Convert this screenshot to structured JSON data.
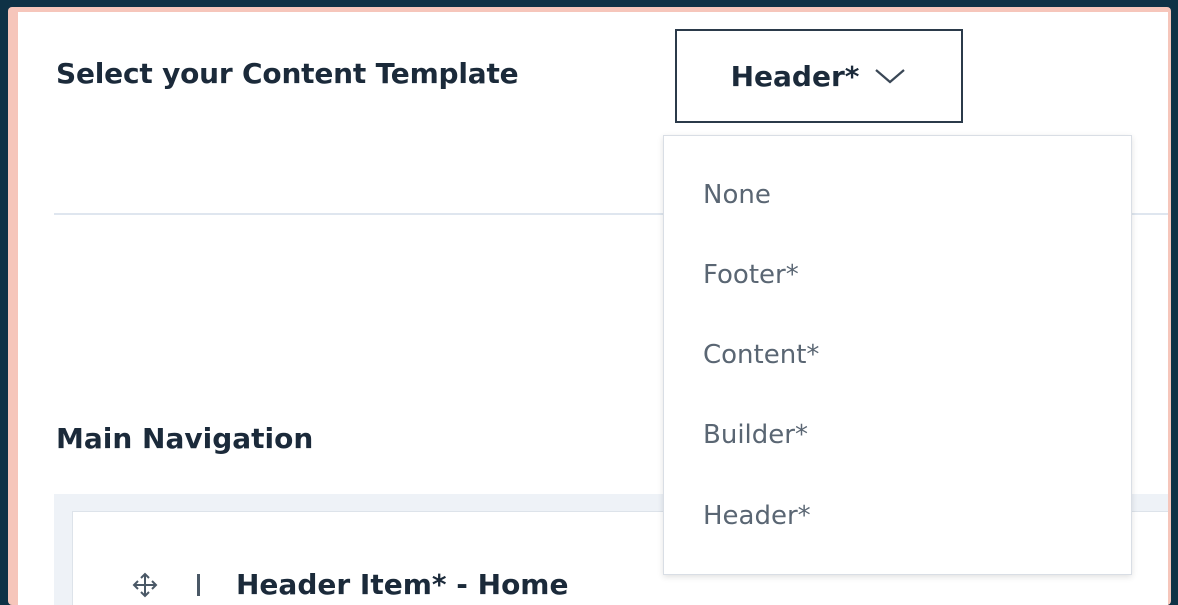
{
  "template_selector": {
    "label": "Select your Content Template",
    "selected_value": "Header*",
    "options": [
      "None",
      "Footer*",
      "Content*",
      "Builder*",
      "Header*"
    ]
  },
  "main_navigation": {
    "heading": "Main Navigation",
    "items": [
      {
        "label": "Header Item* - Home"
      }
    ]
  },
  "icons": {
    "chevron": "chevron-down-icon",
    "move": "move-icon"
  },
  "colors": {
    "background": "#0f3246",
    "frame_border": "#f6c6bb",
    "text_dark": "#1b2a3a",
    "option_text": "#5a6673"
  }
}
